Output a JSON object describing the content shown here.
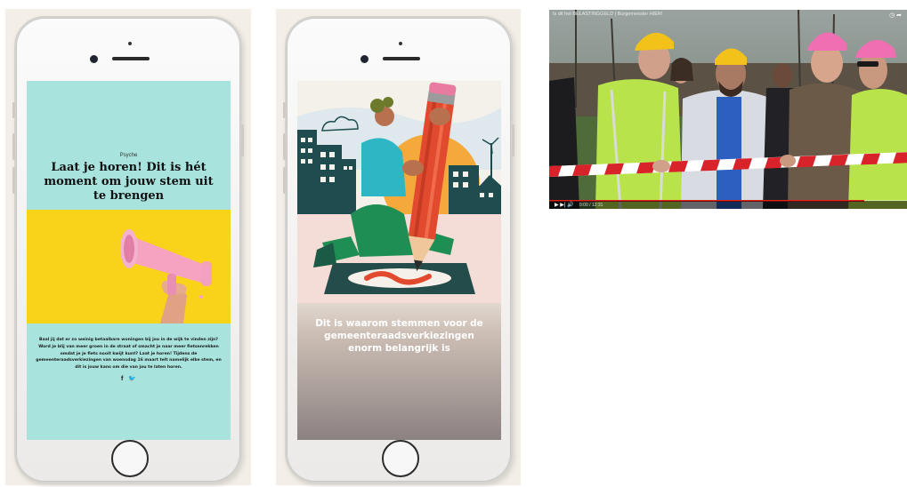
{
  "phone1": {
    "category": "Psyche",
    "title": "Laat je horen! Dit is hét moment om jouw stem uit te brengen",
    "body": "Baal jij dat er zo weinig betaalbare woningen bij jou in de wijk te vinden zijn? Word je blij van meer groen in de straat of smacht je naar meer fietsenrekken omdat je je fiets nooit kwijt kunt? Laat je horen! Tijdens de gemeenteraadsverkiezingen van woensdag 16 maart telt namelijk elke stem, en dit is jouw kans om die van jou te laten horen.",
    "social": {
      "facebook": "f",
      "twitter": "🐦"
    },
    "colors": {
      "background": "#a8e3de",
      "image_bg": "#f9d21a",
      "megaphone": "#f6a3c2"
    }
  },
  "phone2": {
    "caption": "Dit is waarom stemmen voor de gemeenteraadsverkiezingen enorm belangrijk is",
    "colors": {
      "city": "#1f4d4f",
      "sun": "#f5a93a",
      "pencil": "#e14a2e",
      "shirt": "#2fb6c5",
      "pants": "#1f8e55"
    }
  },
  "video": {
    "title": "Is dit het BELASTINGGELD | Burgemeester HIER!",
    "time": "0:00 / 12:31",
    "progress": 0.88,
    "colors": {
      "tape_red": "#d8232a",
      "hardhat_yellow": "#f3c21a",
      "hardhat_pink": "#ef6fb2",
      "vest": "#b9e34a"
    }
  }
}
